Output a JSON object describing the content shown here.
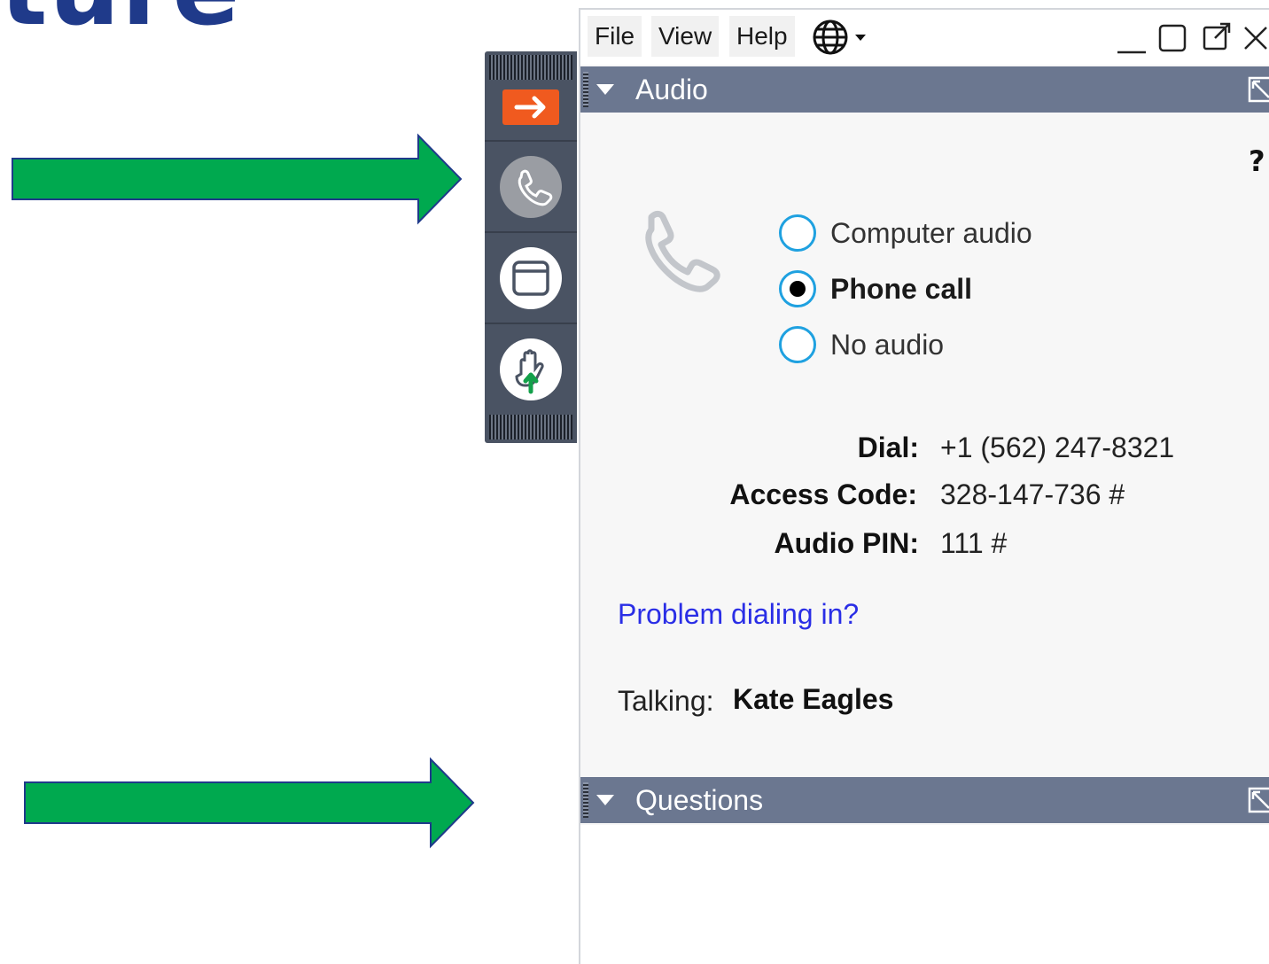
{
  "slide": {
    "heading_fragment": "ture"
  },
  "colors": {
    "arrow_green": "#00a94f",
    "arrow_outline": "#1f3a8a",
    "toolbar_bg": "#4a5363",
    "expand_orange": "#f05a1f",
    "panel_header": "#6b7790",
    "radio_accent": "#1fa1e0",
    "link_blue": "#2a2ee6"
  },
  "toolbar": {
    "buttons": [
      {
        "icon": "arrow-right-icon"
      },
      {
        "icon": "phone-icon"
      },
      {
        "icon": "window-icon"
      },
      {
        "icon": "raise-hand-icon"
      }
    ]
  },
  "menubar": {
    "items": [
      "File",
      "View",
      "Help"
    ],
    "language_icon": "globe-icon",
    "window_controls": [
      "minimize-icon",
      "maximize-icon",
      "popout-icon",
      "close-icon"
    ]
  },
  "audio_panel": {
    "title": "Audio",
    "help": "?",
    "options": [
      {
        "label": "Computer audio",
        "selected": false
      },
      {
        "label": "Phone call",
        "selected": true
      },
      {
        "label": "No audio",
        "selected": false
      }
    ],
    "dial_label": "Dial:",
    "dial_value": "+1 (562) 247-8321",
    "access_label": "Access Code:",
    "access_value": "328-147-736 #",
    "pin_label": "Audio PIN:",
    "pin_value": "111 #",
    "problem_link": "Problem dialing in?",
    "talking_label": "Talking:",
    "talking_name": "Kate Eagles"
  },
  "questions_panel": {
    "title": "Questions"
  }
}
